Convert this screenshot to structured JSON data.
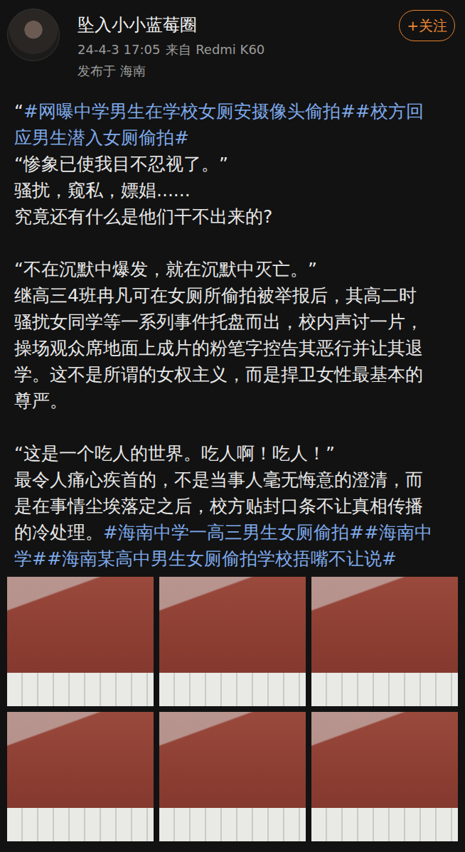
{
  "post": {
    "author": "坠入小小蓝莓圈",
    "follow_button": "+关注",
    "time": "24-4-3 17:05",
    "source": "来自 Redmi K60",
    "location": "发布于 海南",
    "lines": [
      [
        {
          "text": "“",
          "kind": "text"
        },
        {
          "text": "#网曝中学男生在学校女厕安摄像头偷拍##校方回",
          "kind": "hashtag"
        }
      ],
      [
        {
          "text": "应男生潜入女厕偷拍#",
          "kind": "hashtag"
        }
      ],
      [
        {
          "text": "“惨象已使我目不忍视了。”",
          "kind": "text"
        }
      ],
      [
        {
          "text": "骚扰，窥私，嫖娼......",
          "kind": "text"
        }
      ],
      [
        {
          "text": "究竟还有什么是他们干不出来的?",
          "kind": "text"
        }
      ],
      [],
      [
        {
          "text": "“不在沉默中爆发，就在沉默中灭亡。”",
          "kind": "text"
        }
      ],
      [
        {
          "text": "继高三4班冉凡可在女厕所偷拍被举报后，其高二时",
          "kind": "text"
        }
      ],
      [
        {
          "text": "骚扰女同学等一系列事件托盘而出，校内声讨一片，",
          "kind": "text"
        }
      ],
      [
        {
          "text": "操场观众席地面上成片的粉笔字控告其恶行并让其退",
          "kind": "text"
        }
      ],
      [
        {
          "text": "学。这不是所谓的女权主义，而是捍卫女性最基本的",
          "kind": "text"
        }
      ],
      [
        {
          "text": "尊严。",
          "kind": "text"
        }
      ],
      [],
      [
        {
          "text": "“这是一个吃人的世界。吃人啊！吃人！”",
          "kind": "text"
        }
      ],
      [
        {
          "text": "最令人痛心疾首的，不是当事人毫无悔意的澄清，而",
          "kind": "text"
        }
      ],
      [
        {
          "text": "是在事情尘埃落定之后，校方贴封口条不让真相传播",
          "kind": "text"
        }
      ],
      [
        {
          "text": "的冷处理。",
          "kind": "text"
        },
        {
          "text": "#海南中学一高三男生女厕偷拍##海南中",
          "kind": "hashtag"
        }
      ],
      [
        {
          "text": "学##海南某高中男生女厕偷拍学校捂嘴不让说#",
          "kind": "hashtag"
        }
      ]
    ]
  }
}
